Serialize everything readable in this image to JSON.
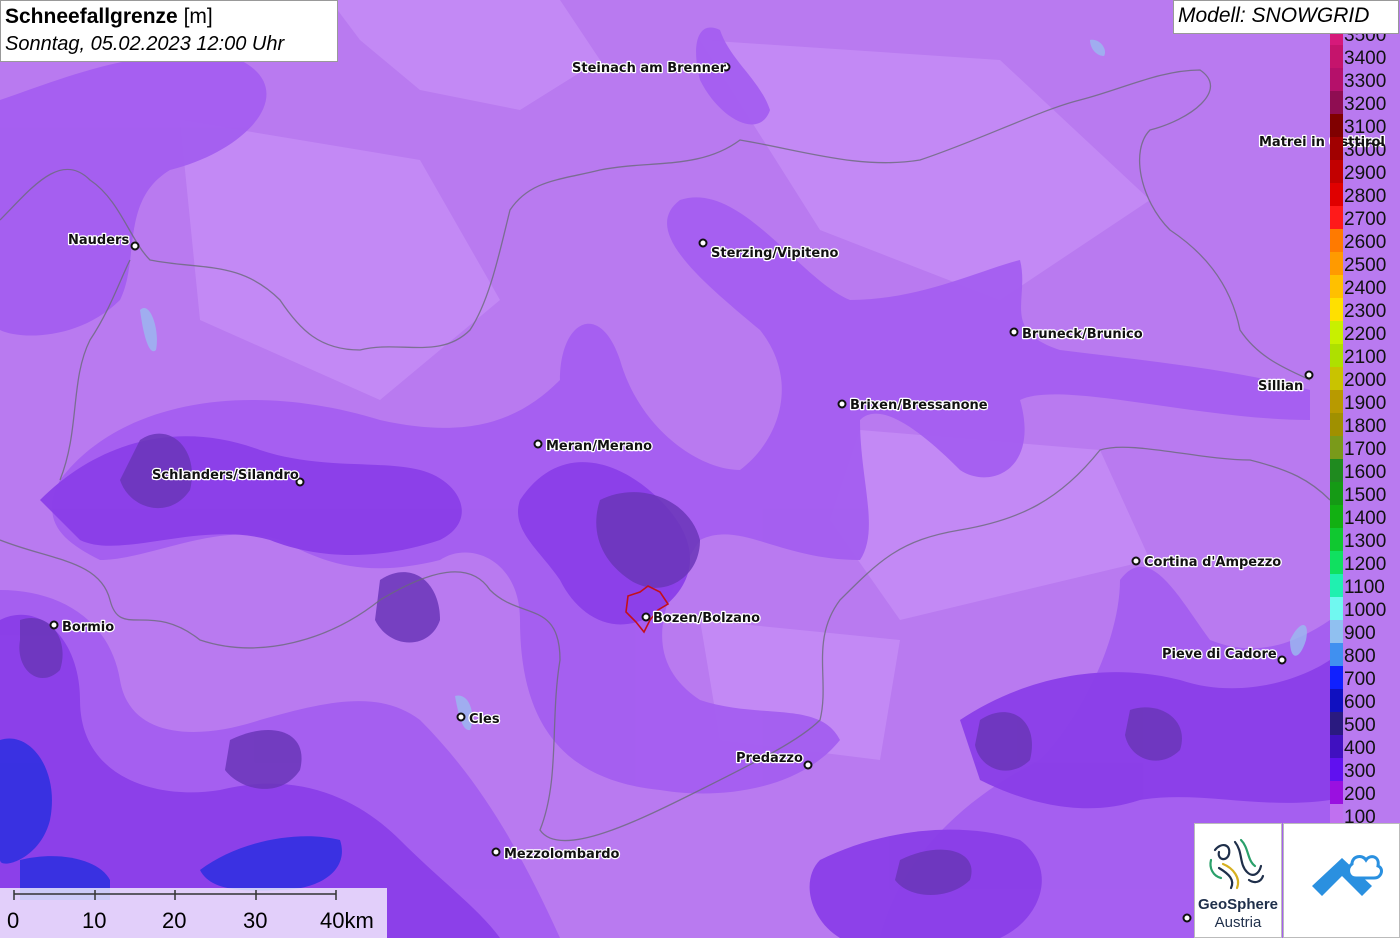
{
  "title": {
    "main": "Schneefallgrenze",
    "unit": "[m]",
    "date": "Sonntag, 05.02.2023 12:00 Uhr"
  },
  "model": {
    "label": "Modell: SNOWGRID"
  },
  "legend": {
    "entries": [
      {
        "label": "3500",
        "color": "#d6197a"
      },
      {
        "label": "3400",
        "color": "#c5146c"
      },
      {
        "label": "3300",
        "color": "#b5106a"
      },
      {
        "label": "3200",
        "color": "#8f0d52"
      },
      {
        "label": "3100",
        "color": "#800000"
      },
      {
        "label": "3000",
        "color": "#a10000"
      },
      {
        "label": "2900",
        "color": "#c20000"
      },
      {
        "label": "2800",
        "color": "#e00000"
      },
      {
        "label": "2700",
        "color": "#ff1a1a"
      },
      {
        "label": "2600",
        "color": "#ff7a00"
      },
      {
        "label": "2500",
        "color": "#ff9a00"
      },
      {
        "label": "2400",
        "color": "#ffc000"
      },
      {
        "label": "2300",
        "color": "#ffe000"
      },
      {
        "label": "2200",
        "color": "#c8f000"
      },
      {
        "label": "2100",
        "color": "#aee000"
      },
      {
        "label": "2000",
        "color": "#c9c300"
      },
      {
        "label": "1900",
        "color": "#b89a00"
      },
      {
        "label": "1800",
        "color": "#a09000"
      },
      {
        "label": "1700",
        "color": "#7a9a1a"
      },
      {
        "label": "1600",
        "color": "#1f8a1f"
      },
      {
        "label": "1500",
        "color": "#159a15"
      },
      {
        "label": "1400",
        "color": "#12b012"
      },
      {
        "label": "1300",
        "color": "#10c830"
      },
      {
        "label": "1200",
        "color": "#10e060"
      },
      {
        "label": "1100",
        "color": "#20f0b0"
      },
      {
        "label": "1000",
        "color": "#70f8f0"
      },
      {
        "label": "900",
        "color": "#90c0f0"
      },
      {
        "label": "800",
        "color": "#4090f0"
      },
      {
        "label": "700",
        "color": "#1020ff"
      },
      {
        "label": "600",
        "color": "#1010c0"
      },
      {
        "label": "500",
        "color": "#2a1a80"
      },
      {
        "label": "400",
        "color": "#4010c0"
      },
      {
        "label": "300",
        "color": "#6010f0"
      },
      {
        "label": "200",
        "color": "#9a10e0"
      },
      {
        "label": "100",
        "color": "#c070f0"
      }
    ]
  },
  "cities": [
    {
      "name": "Steinach am Brenner"
    },
    {
      "name": "Nauders"
    },
    {
      "name": "Sterzing/Vipiteno"
    },
    {
      "name": "Matrei in Osttirol"
    },
    {
      "name": "Bruneck/Brunico"
    },
    {
      "name": "Sillian"
    },
    {
      "name": "Brixen/Bressanone"
    },
    {
      "name": "Meran/Merano"
    },
    {
      "name": "Schlanders/Silandro"
    },
    {
      "name": "Cortina d'Ampezzo"
    },
    {
      "name": "Bormio"
    },
    {
      "name": "Bozen/Bolzano"
    },
    {
      "name": "Pieve di Cadore"
    },
    {
      "name": "Cles"
    },
    {
      "name": "Predazzo"
    },
    {
      "name": "Mezzolombardo"
    }
  ],
  "scalebar": {
    "labels": [
      "0",
      "10",
      "20",
      "30",
      "40km"
    ]
  },
  "logos": {
    "geosphere_line1": "GeoSphere",
    "geosphere_line2": "Austria"
  },
  "colors": {
    "base_purple": "#b97af0",
    "mid_purple": "#9b4fe8",
    "dark_purple": "#7a32d8",
    "deep_purple": "#5a28b8",
    "darkest": "#3a1a80",
    "blue": "#2b2fe0"
  }
}
